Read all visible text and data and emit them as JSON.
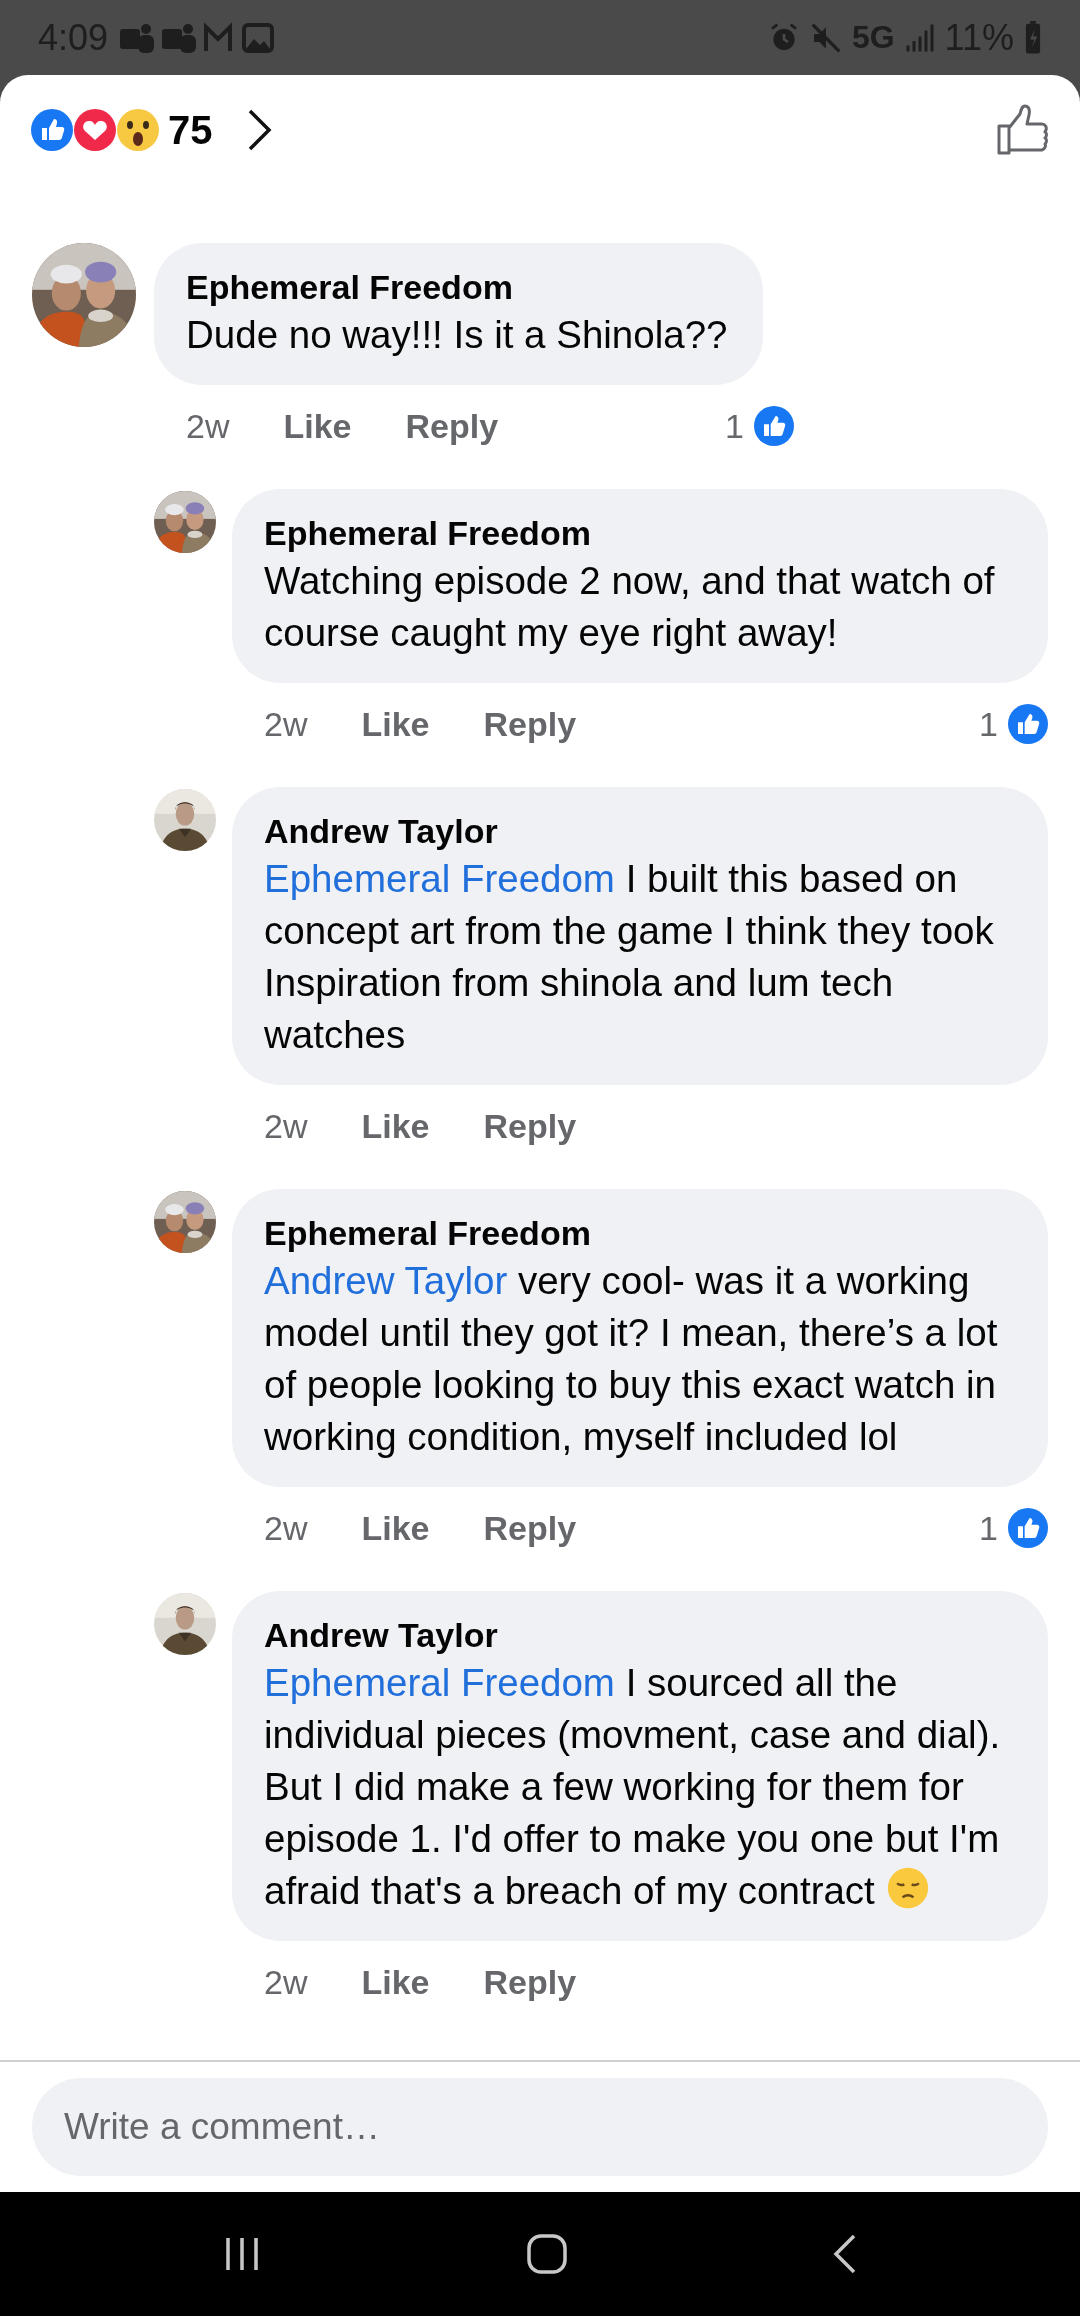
{
  "status_bar": {
    "time": "4:09",
    "network": "5G",
    "battery": "11%"
  },
  "header": {
    "reaction_count": "75"
  },
  "comments": [
    {
      "author": "Ephemeral Freedom",
      "segments": [
        {
          "kind": "text",
          "text": "Dude no way!!! Is it a Shinola??"
        }
      ],
      "time": "2w",
      "like": "Like",
      "reply": "Reply",
      "likes": "1",
      "children": [
        {
          "author": "Ephemeral Freedom",
          "segments": [
            {
              "kind": "text",
              "text": "Watching episode 2 now, and that watch of course caught my eye right away!"
            }
          ],
          "time": "2w",
          "like": "Like",
          "reply": "Reply",
          "likes": "1"
        },
        {
          "author": "Andrew Taylor",
          "segments": [
            {
              "kind": "mention",
              "text": "Ephemeral Freedom"
            },
            {
              "kind": "text",
              "text": " I built this based on concept art from the game I think they took Inspiration from shinola and lum tech watches"
            }
          ],
          "time": "2w",
          "like": "Like",
          "reply": "Reply"
        },
        {
          "author": "Ephemeral Freedom",
          "segments": [
            {
              "kind": "mention",
              "text": "Andrew Taylor"
            },
            {
              "kind": "text",
              "text": " very cool- was it a working model until they got it? I mean, there’s a lot of people looking to buy this exact watch in working condition, myself included lol"
            }
          ],
          "time": "2w",
          "like": "Like",
          "reply": "Reply",
          "likes": "1"
        },
        {
          "author": "Andrew Taylor",
          "segments": [
            {
              "kind": "mention",
              "text": "Ephemeral Freedom"
            },
            {
              "kind": "text",
              "text": " I sourced all the individual pieces (movment, case and dial). But I did make a few working for them for episode 1. I'd offer to make you one but I'm afraid that's a breach of my contract "
            },
            {
              "kind": "emoji"
            }
          ],
          "time": "2w",
          "like": "Like",
          "reply": "Reply"
        }
      ]
    }
  ],
  "composer": {
    "placeholder": "Write a comment…"
  }
}
